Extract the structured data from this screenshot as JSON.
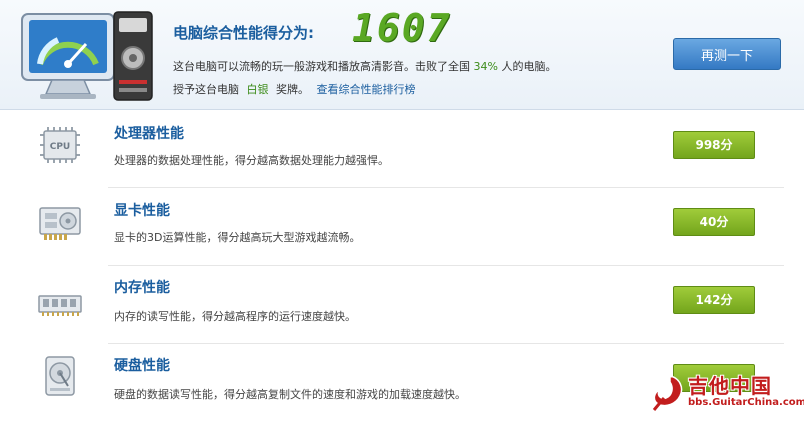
{
  "header": {
    "score_label": "电脑综合性能得分为:",
    "score": "1607",
    "desc_prefix": "这台电脑可以流畅的玩一般游戏和播放高清影音。击败了全国",
    "beat_percent": "34%",
    "desc_suffix": "人的电脑。",
    "award_prefix": "授予这台电脑",
    "medal": "白银",
    "award_suffix": "奖牌。",
    "rank_link": "查看综合性能排行榜",
    "retest_label": "再测一下"
  },
  "items": [
    {
      "title": "处理器性能",
      "desc": "处理器的数据处理性能，得分越高数据处理能力越强悍。",
      "score": "998分",
      "icon": "cpu-icon",
      "icon_text": "CPU"
    },
    {
      "title": "显卡性能",
      "desc": "显卡的3D运算性能，得分越高玩大型游戏越流畅。",
      "score": "40分",
      "icon": "graphics-card-icon"
    },
    {
      "title": "内存性能",
      "desc": "内存的读写性能，得分越高程序的运行速度越快。",
      "score": "142分",
      "icon": "memory-icon"
    },
    {
      "title": "硬盘性能",
      "desc": "硬盘的数据读写性能，得分越高复制文件的速度和游戏的加载速度越快。",
      "score": "",
      "icon": "hard-disk-icon"
    }
  ],
  "watermark": {
    "text": "吉他中国",
    "url": "bbs.GuitarChina.com"
  },
  "colors": {
    "title_blue": "#1b5e9f",
    "score_green": "#5aa824",
    "badge_green": "#7fb22a",
    "button_blue": "#3479c4",
    "watermark_red": "#c21d1d"
  }
}
